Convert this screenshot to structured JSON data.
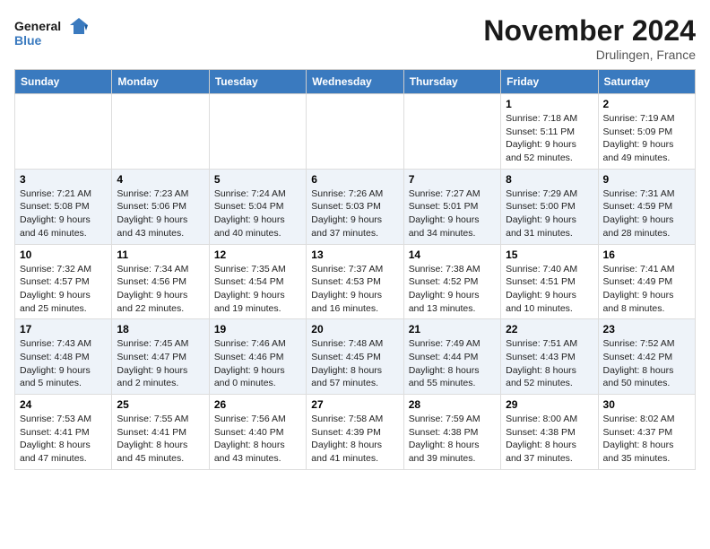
{
  "header": {
    "logo_line1": "General",
    "logo_line2": "Blue",
    "month_title": "November 2024",
    "location": "Drulingen, France"
  },
  "columns": [
    "Sunday",
    "Monday",
    "Tuesday",
    "Wednesday",
    "Thursday",
    "Friday",
    "Saturday"
  ],
  "weeks": [
    [
      {
        "day": "",
        "info": ""
      },
      {
        "day": "",
        "info": ""
      },
      {
        "day": "",
        "info": ""
      },
      {
        "day": "",
        "info": ""
      },
      {
        "day": "",
        "info": ""
      },
      {
        "day": "1",
        "info": "Sunrise: 7:18 AM\nSunset: 5:11 PM\nDaylight: 9 hours\nand 52 minutes."
      },
      {
        "day": "2",
        "info": "Sunrise: 7:19 AM\nSunset: 5:09 PM\nDaylight: 9 hours\nand 49 minutes."
      }
    ],
    [
      {
        "day": "3",
        "info": "Sunrise: 7:21 AM\nSunset: 5:08 PM\nDaylight: 9 hours\nand 46 minutes."
      },
      {
        "day": "4",
        "info": "Sunrise: 7:23 AM\nSunset: 5:06 PM\nDaylight: 9 hours\nand 43 minutes."
      },
      {
        "day": "5",
        "info": "Sunrise: 7:24 AM\nSunset: 5:04 PM\nDaylight: 9 hours\nand 40 minutes."
      },
      {
        "day": "6",
        "info": "Sunrise: 7:26 AM\nSunset: 5:03 PM\nDaylight: 9 hours\nand 37 minutes."
      },
      {
        "day": "7",
        "info": "Sunrise: 7:27 AM\nSunset: 5:01 PM\nDaylight: 9 hours\nand 34 minutes."
      },
      {
        "day": "8",
        "info": "Sunrise: 7:29 AM\nSunset: 5:00 PM\nDaylight: 9 hours\nand 31 minutes."
      },
      {
        "day": "9",
        "info": "Sunrise: 7:31 AM\nSunset: 4:59 PM\nDaylight: 9 hours\nand 28 minutes."
      }
    ],
    [
      {
        "day": "10",
        "info": "Sunrise: 7:32 AM\nSunset: 4:57 PM\nDaylight: 9 hours\nand 25 minutes."
      },
      {
        "day": "11",
        "info": "Sunrise: 7:34 AM\nSunset: 4:56 PM\nDaylight: 9 hours\nand 22 minutes."
      },
      {
        "day": "12",
        "info": "Sunrise: 7:35 AM\nSunset: 4:54 PM\nDaylight: 9 hours\nand 19 minutes."
      },
      {
        "day": "13",
        "info": "Sunrise: 7:37 AM\nSunset: 4:53 PM\nDaylight: 9 hours\nand 16 minutes."
      },
      {
        "day": "14",
        "info": "Sunrise: 7:38 AM\nSunset: 4:52 PM\nDaylight: 9 hours\nand 13 minutes."
      },
      {
        "day": "15",
        "info": "Sunrise: 7:40 AM\nSunset: 4:51 PM\nDaylight: 9 hours\nand 10 minutes."
      },
      {
        "day": "16",
        "info": "Sunrise: 7:41 AM\nSunset: 4:49 PM\nDaylight: 9 hours\nand 8 minutes."
      }
    ],
    [
      {
        "day": "17",
        "info": "Sunrise: 7:43 AM\nSunset: 4:48 PM\nDaylight: 9 hours\nand 5 minutes."
      },
      {
        "day": "18",
        "info": "Sunrise: 7:45 AM\nSunset: 4:47 PM\nDaylight: 9 hours\nand 2 minutes."
      },
      {
        "day": "19",
        "info": "Sunrise: 7:46 AM\nSunset: 4:46 PM\nDaylight: 9 hours\nand 0 minutes."
      },
      {
        "day": "20",
        "info": "Sunrise: 7:48 AM\nSunset: 4:45 PM\nDaylight: 8 hours\nand 57 minutes."
      },
      {
        "day": "21",
        "info": "Sunrise: 7:49 AM\nSunset: 4:44 PM\nDaylight: 8 hours\nand 55 minutes."
      },
      {
        "day": "22",
        "info": "Sunrise: 7:51 AM\nSunset: 4:43 PM\nDaylight: 8 hours\nand 52 minutes."
      },
      {
        "day": "23",
        "info": "Sunrise: 7:52 AM\nSunset: 4:42 PM\nDaylight: 8 hours\nand 50 minutes."
      }
    ],
    [
      {
        "day": "24",
        "info": "Sunrise: 7:53 AM\nSunset: 4:41 PM\nDaylight: 8 hours\nand 47 minutes."
      },
      {
        "day": "25",
        "info": "Sunrise: 7:55 AM\nSunset: 4:41 PM\nDaylight: 8 hours\nand 45 minutes."
      },
      {
        "day": "26",
        "info": "Sunrise: 7:56 AM\nSunset: 4:40 PM\nDaylight: 8 hours\nand 43 minutes."
      },
      {
        "day": "27",
        "info": "Sunrise: 7:58 AM\nSunset: 4:39 PM\nDaylight: 8 hours\nand 41 minutes."
      },
      {
        "day": "28",
        "info": "Sunrise: 7:59 AM\nSunset: 4:38 PM\nDaylight: 8 hours\nand 39 minutes."
      },
      {
        "day": "29",
        "info": "Sunrise: 8:00 AM\nSunset: 4:38 PM\nDaylight: 8 hours\nand 37 minutes."
      },
      {
        "day": "30",
        "info": "Sunrise: 8:02 AM\nSunset: 4:37 PM\nDaylight: 8 hours\nand 35 minutes."
      }
    ]
  ]
}
